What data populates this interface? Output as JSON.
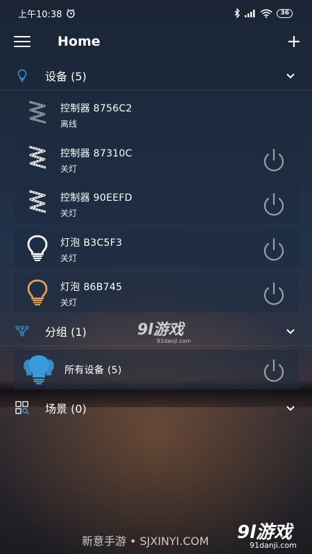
{
  "status_bar": {
    "time": "上午10:38",
    "battery": "36"
  },
  "toolbar": {
    "title": "Home"
  },
  "sections": {
    "devices": {
      "label": "设备 (5)"
    },
    "groups": {
      "label": "分组 (1)"
    },
    "scenes": {
      "label": "场景 (0)"
    }
  },
  "devices": [
    {
      "name": "控制器  8756C2",
      "status": "离线",
      "icon": "led-strip-icon"
    },
    {
      "name": "控制器  87310C",
      "status": "关灯",
      "icon": "led-strip-icon"
    },
    {
      "name": "控制器  90EEFD",
      "status": "关灯",
      "icon": "led-strip-icon"
    },
    {
      "name": "灯泡  B3C5F3",
      "status": "关灯",
      "icon": "bulb-icon"
    },
    {
      "name": "灯泡  86B745",
      "status": "关灯",
      "icon": "bulb-icon"
    }
  ],
  "groups": [
    {
      "name": "所有设备 (5)",
      "icon": "group-bulb-icon"
    }
  ],
  "watermarks": {
    "logo_mid": "9l游戏",
    "logo_mid_sub": "91danji.com",
    "footer": "新意手游 • SJXINYI.COM",
    "logo_br": "9l游戏",
    "logo_br_sub": "91danji.com"
  },
  "colors": {
    "accent_blue": "#3a9bdc",
    "bulb_orange": "#e0a060",
    "bulb_white": "#ffffff",
    "power_gray": "#9aa0a8"
  }
}
